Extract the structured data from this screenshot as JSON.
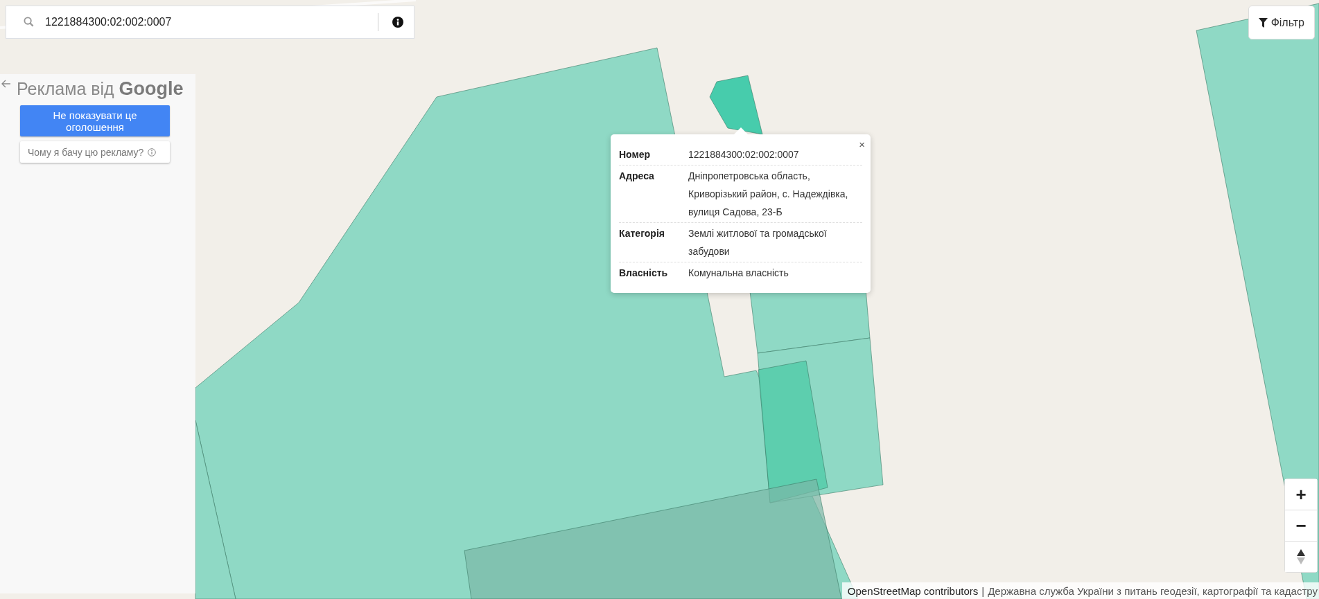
{
  "search": {
    "value": "1221884300:02:002:0007"
  },
  "filter_button": {
    "label": "Фільтр"
  },
  "ad_panel": {
    "title": "Реклама від",
    "brand": "Google",
    "hide_button": "Не показувати це оголошення",
    "why_button": "Чому я бачу цю рекламу?"
  },
  "popup": {
    "close": "×",
    "rows": [
      {
        "label": "Номер",
        "value": "1221884300:02:002:0007"
      },
      {
        "label": "Адреса",
        "value": "Дніпропетровська область, Криворізький район, с. Надеждівка, вулиця Садова, 23-Б"
      },
      {
        "label": "Категорія",
        "value": "Землі житлової та громадської забудови"
      },
      {
        "label": "Власність",
        "value": "Комунальна власність"
      }
    ]
  },
  "zoom_controls": {
    "zoom_in": "+",
    "zoom_out": "−"
  },
  "attribution": {
    "link": "OpenStreetMap contributors",
    "separator": "|",
    "text": "Державна служба України з питань геодезії, картографії та кадастру"
  }
}
